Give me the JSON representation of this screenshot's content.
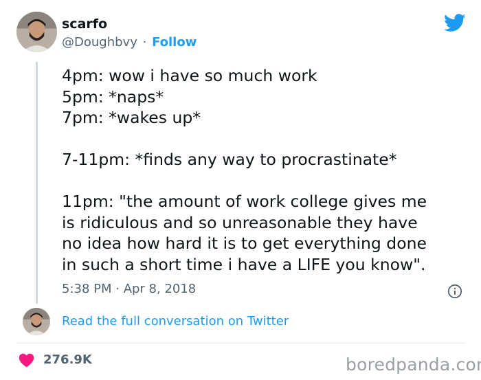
{
  "author": {
    "display_name": "scarfo",
    "handle": "@Doughbvy",
    "separator": "·",
    "follow_label": "Follow"
  },
  "tweet": {
    "lines": [
      "4pm: wow i have so much work",
      "5pm: *naps*",
      "7pm: *wakes up*",
      "",
      "7-11pm: *finds any way to procrastinate*",
      "",
      "11pm: \"the amount of work college gives me",
      "is ridiculous and so unreasonable they have",
      "no idea how hard it is to get everything done",
      "in such a short time i have a LIFE you know\"."
    ],
    "timestamp": "5:38 PM · Apr 8, 2018"
  },
  "conversation": {
    "link_label": "Read the full conversation on Twitter"
  },
  "engagement": {
    "like_count": "276.9K"
  },
  "watermark": "boredpanda.com",
  "icons": {
    "logo": "twitter-bird-icon",
    "info": "info-icon",
    "like": "heart-icon"
  },
  "colors": {
    "accent": "#1d9bf0",
    "heart": "#f91880",
    "muted": "#536471",
    "thread_line": "#cfd9de"
  }
}
